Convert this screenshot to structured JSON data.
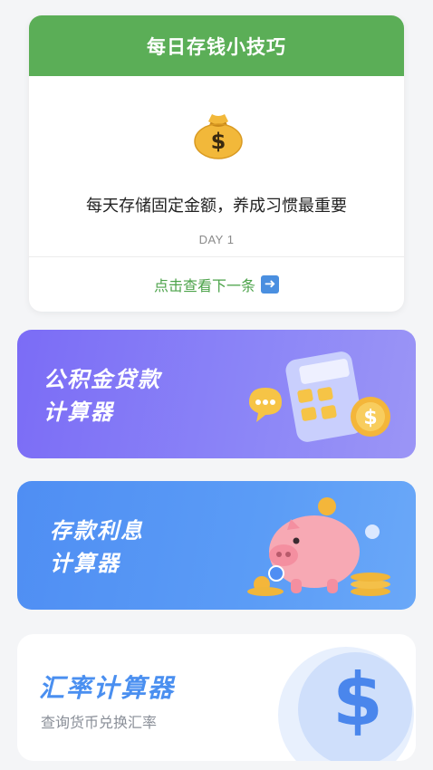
{
  "tip_card": {
    "title": "每日存钱小技巧",
    "icon": "money-bag-icon",
    "tip_text": "每天存储固定金额，养成习惯最重要",
    "day_label": "DAY 1",
    "next_label": "点击查看下一条",
    "next_icon": "right-arrow-icon"
  },
  "banners": {
    "loan": {
      "line1": "公积金贷款",
      "line2": "计算器",
      "icon": "calculator-icon"
    },
    "deposit": {
      "line1": "存款利息",
      "line2": "计算器",
      "icon": "piggy-bank-icon"
    }
  },
  "exchange": {
    "title": "汇率计算器",
    "subtitle": "查询货币兑换汇率",
    "icon": "dollar-icon",
    "symbol": "$"
  },
  "colors": {
    "tip_header": "#5bae57",
    "next_text": "#4ca34a",
    "loan_banner": "#7b6cf6",
    "deposit_banner": "#4f8ef3",
    "exchange_accent": "#4a8ff0"
  }
}
